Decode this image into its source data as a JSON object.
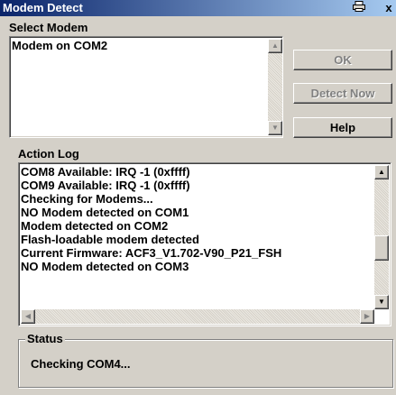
{
  "window": {
    "title": "Modem Detect",
    "icon_button": "printer-icon",
    "close_glyph": "x"
  },
  "select_modem": {
    "label": "Select Modem",
    "items": [
      "Modem on COM2"
    ]
  },
  "buttons": {
    "ok": "OK",
    "detect_now": "Detect Now",
    "help": "Help"
  },
  "action_log": {
    "label": "Action Log",
    "lines": [
      " COM8 Available: IRQ -1 (0xffff)",
      " COM9 Available: IRQ -1 (0xffff)",
      "Checking for Modems...",
      " NO Modem detected on COM1",
      " Modem detected on COM2",
      "  Flash-loadable modem detected",
      "  Current Firmware: ACF3_V1.702-V90_P21_FSH",
      " NO Modem detected on COM3"
    ]
  },
  "status": {
    "label": "Status",
    "text": "Checking COM4..."
  },
  "colors": {
    "title_start": "#0a246a",
    "title_end": "#a6caf0",
    "face": "#d4d0c8"
  }
}
